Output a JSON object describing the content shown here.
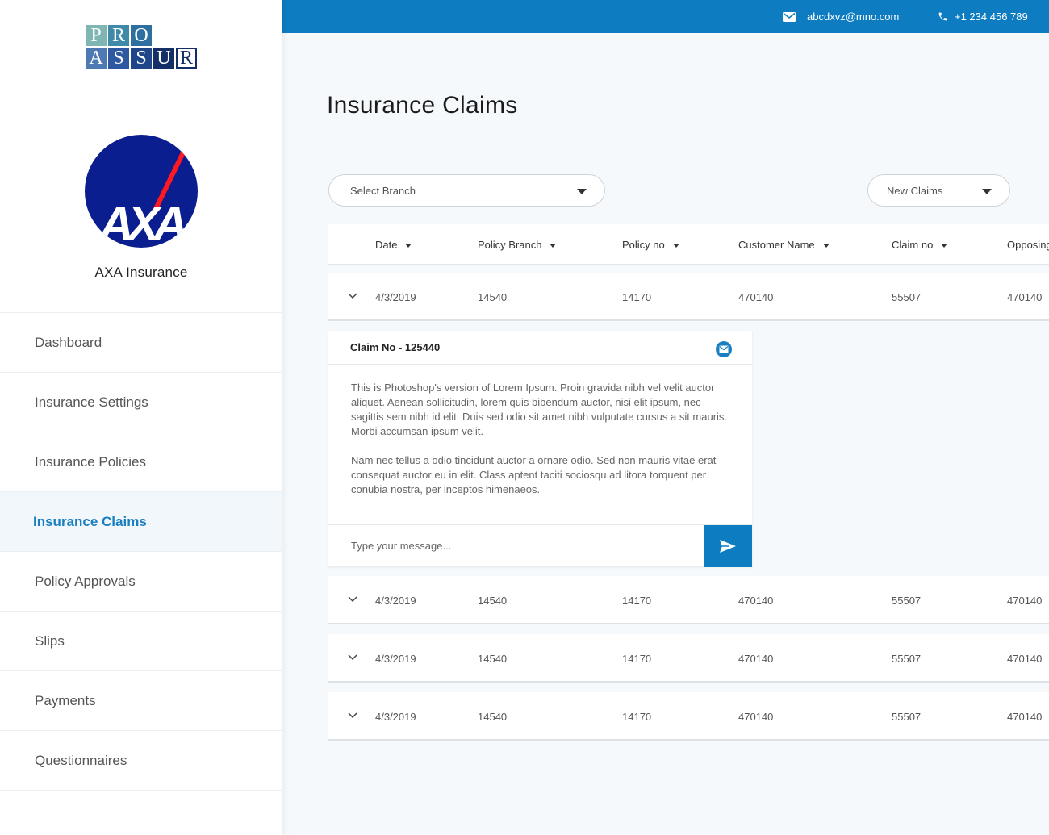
{
  "brand": {
    "logo_top": [
      "P",
      "R",
      "O"
    ],
    "logo_bottom": [
      "A",
      "S",
      "S",
      "U",
      "R"
    ]
  },
  "profile": {
    "company_name": "AXA Insurance",
    "badge_text": "AXA"
  },
  "sidebar": {
    "items": [
      {
        "label": "Dashboard"
      },
      {
        "label": "Insurance Settings"
      },
      {
        "label": "Insurance Policies"
      },
      {
        "label": "Insurance Claims",
        "active": true
      },
      {
        "label": "Policy Approvals"
      },
      {
        "label": "Slips"
      },
      {
        "label": "Payments"
      },
      {
        "label": "Questionnaires"
      }
    ]
  },
  "topbar": {
    "email": "abcdxvz@mno.com",
    "phone": "+1 234 456 789",
    "color": "#0d7cc1"
  },
  "main": {
    "title": "Insurance Claims",
    "branch_select": "Select Branch",
    "claims_filter": "New Claims"
  },
  "table": {
    "columns": [
      "Date",
      "Policy Branch",
      "Policy no",
      "Customer Name",
      "Claim no",
      "Opposing"
    ],
    "rows": [
      [
        "4/3/2019",
        "14540",
        "14170",
        "470140",
        "55507",
        "470140"
      ],
      [
        "4/3/2019",
        "14540",
        "14170",
        "470140",
        "55507",
        "470140"
      ],
      [
        "4/3/2019",
        "14540",
        "14170",
        "470140",
        "55507",
        "470140"
      ],
      [
        "4/3/2019",
        "14540",
        "14170",
        "470140",
        "55507",
        "470140"
      ]
    ]
  },
  "claim_panel": {
    "title": "Claim No - 125440",
    "paragraph_1": "This is Photoshop's version  of Lorem Ipsum. Proin gravida nibh vel velit auctor aliquet. Aenean sollicitudin, lorem quis bibendum auctor, nisi elit ipsum, nec sagittis sem nibh id elit. Duis sed odio sit amet nibh vulputate cursus a sit mauris. Morbi accumsan ipsum velit.",
    "paragraph_2": "Nam nec tellus a odio tincidunt auctor a ornare odio. Sed non  mauris vitae erat consequat auctor eu in elit. Class aptent taciti sociosqu ad litora torquent per conubia nostra, per inceptos himenaeos.",
    "message_placeholder": "Type your message..."
  },
  "icons": {
    "email": "envelope-icon",
    "phone": "phone-icon",
    "row_toggle": "chevron-down-icon",
    "mail": "mail-icon",
    "send": "send-icon"
  }
}
